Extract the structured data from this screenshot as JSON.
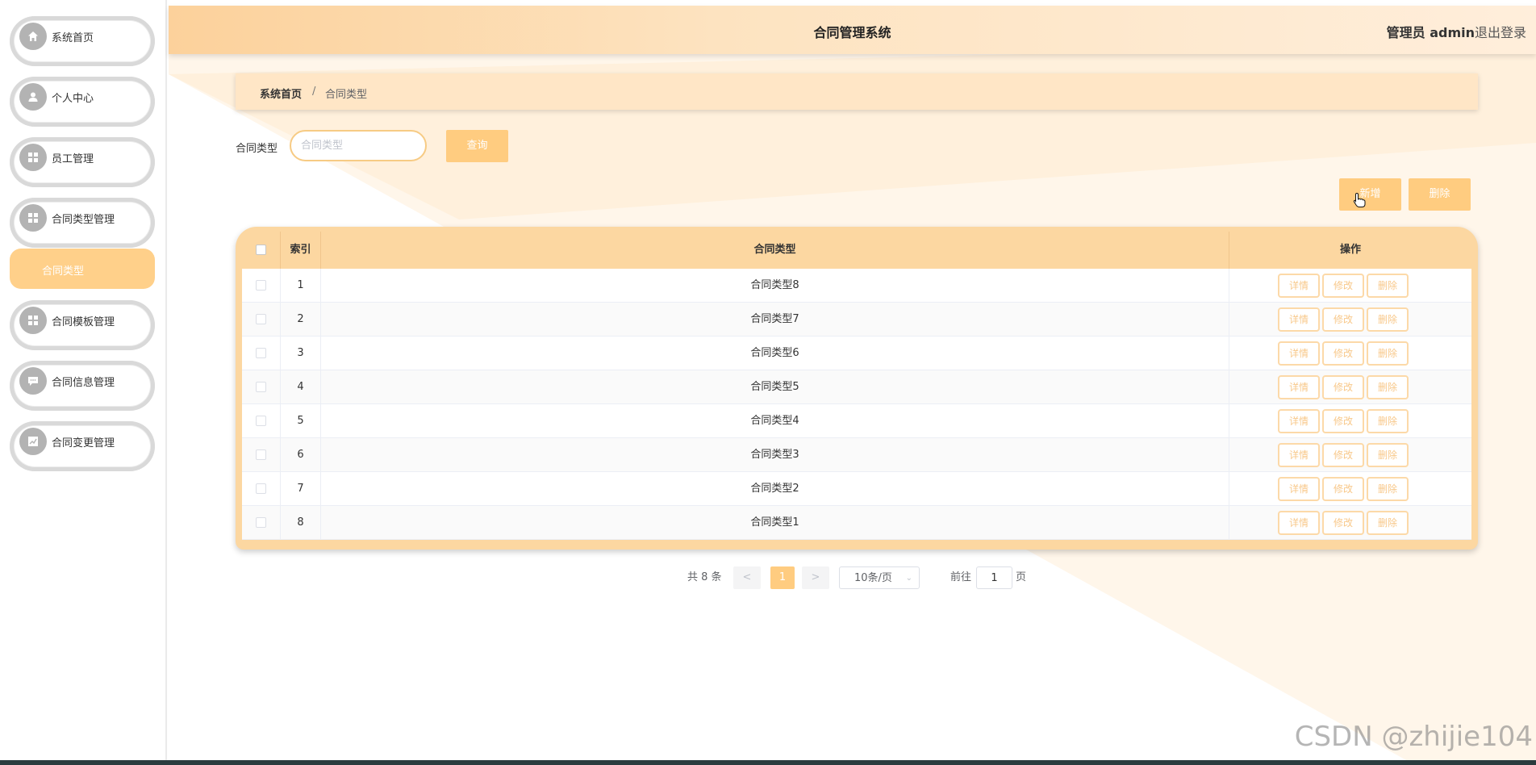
{
  "app": {
    "title": "合同管理系统",
    "user": "管理员 admin",
    "logout": "退出登录"
  },
  "sidebar": {
    "items": [
      {
        "label": "系统首页",
        "icon": "home-icon"
      },
      {
        "label": "个人中心",
        "icon": "user-icon"
      },
      {
        "label": "员工管理",
        "icon": "grid-icon"
      },
      {
        "label": "合同类型管理",
        "icon": "grid-icon"
      },
      {
        "label": "合同模板管理",
        "icon": "grid-icon"
      },
      {
        "label": "合同信息管理",
        "icon": "chat-icon"
      },
      {
        "label": "合同变更管理",
        "icon": "chart-icon"
      }
    ],
    "sub_item": "合同类型"
  },
  "breadcrumb": {
    "home": "系统首页",
    "sep": "/",
    "current": "合同类型"
  },
  "search": {
    "label": "合同类型",
    "placeholder": "合同类型",
    "button": "查询"
  },
  "actions": {
    "add": "新增",
    "delete": "删除"
  },
  "table": {
    "headers": {
      "index": "索引",
      "type": "合同类型",
      "ops": "操作"
    },
    "rows": [
      {
        "index": "1",
        "type": "合同类型8"
      },
      {
        "index": "2",
        "type": "合同类型7"
      },
      {
        "index": "3",
        "type": "合同类型6"
      },
      {
        "index": "4",
        "type": "合同类型5"
      },
      {
        "index": "5",
        "type": "合同类型4"
      },
      {
        "index": "6",
        "type": "合同类型3"
      },
      {
        "index": "7",
        "type": "合同类型2"
      },
      {
        "index": "8",
        "type": "合同类型1"
      }
    ],
    "row_ops": {
      "detail": "详情",
      "edit": "修改",
      "delete": "删除"
    }
  },
  "pagination": {
    "total": "共 8 条",
    "prev": "<",
    "current": "1",
    "next": ">",
    "page_size": "10条/页",
    "goto": "前往",
    "jump_value": "1",
    "page_suffix": "页"
  },
  "watermark": "CSDN @zhijie104",
  "colors": {
    "accent": "#ffcc80",
    "header_start": "#fcd19b",
    "main_bg": "#fff6ea"
  }
}
